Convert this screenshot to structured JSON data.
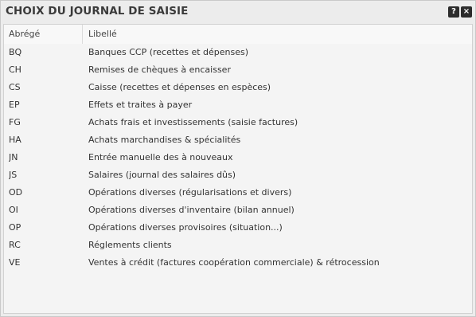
{
  "dialog": {
    "title": "CHOIX DU JOURNAL DE SAISIE",
    "help_label": "?",
    "close_label": "×"
  },
  "table": {
    "columns": [
      "Abrégé",
      "Libellé"
    ],
    "rows": [
      {
        "code": "BQ",
        "label": "Banques CCP (recettes et dépenses)"
      },
      {
        "code": "CH",
        "label": "Remises de chèques à encaisser"
      },
      {
        "code": "CS",
        "label": "Caisse (recettes et dépenses en espèces)"
      },
      {
        "code": "EP",
        "label": "Effets et traites à payer"
      },
      {
        "code": "FG",
        "label": "Achats frais et investissements (saisie factures)"
      },
      {
        "code": "HA",
        "label": "Achats marchandises & spécialités"
      },
      {
        "code": "JN",
        "label": "Entrée manuelle des à nouveaux"
      },
      {
        "code": "JS",
        "label": "Salaires (journal des salaires dûs)"
      },
      {
        "code": "OD",
        "label": "Opérations diverses (régularisations et divers)"
      },
      {
        "code": "OI",
        "label": "Opérations diverses d'inventaire (bilan annuel)"
      },
      {
        "code": "OP",
        "label": "Opérations diverses provisoires (situation...)"
      },
      {
        "code": "RC",
        "label": "Réglements clients"
      },
      {
        "code": "VE",
        "label": "Ventes à crédit (factures coopération commerciale) & rétrocession"
      }
    ]
  }
}
